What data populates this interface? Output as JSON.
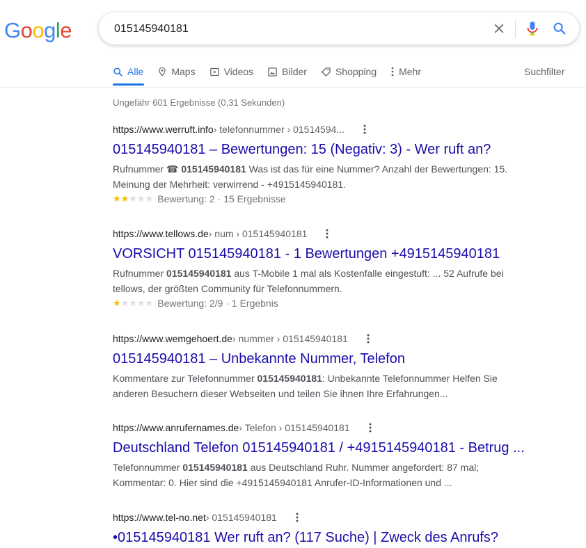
{
  "header": {
    "logo_letters": [
      "G",
      "o",
      "o",
      "g",
      "l",
      "e"
    ],
    "logo_colors": [
      "#4285F4",
      "#EA4335",
      "#FBBC05",
      "#4285F4",
      "#34A853",
      "#EA4335"
    ],
    "search_value": "015145940181"
  },
  "tabs": [
    {
      "label": "Alle",
      "icon": "search-icon",
      "active": true
    },
    {
      "label": "Maps",
      "icon": "map-pin-icon",
      "active": false
    },
    {
      "label": "Videos",
      "icon": "video-icon",
      "active": false
    },
    {
      "label": "Bilder",
      "icon": "image-icon",
      "active": false
    },
    {
      "label": "Shopping",
      "icon": "tag-icon",
      "active": false
    },
    {
      "label": "Mehr",
      "icon": "more-vert-icon",
      "active": false
    }
  ],
  "suchfilter_label": "Suchfilter",
  "stats": "Ungefähr 601 Ergebnisse (0,31 Sekunden)",
  "results": [
    {
      "domain": "https://www.werruft.info",
      "crumbs": " › telefonnummer › 01514594...",
      "title": "015145940181 – Bewertungen: 15 (Negativ: 3) - Wer ruft an?",
      "snippet": [
        {
          "t": "Rufnummer ☎ ",
          "b": false
        },
        {
          "t": "015145940181",
          "b": true
        },
        {
          "t": " Was ist das für eine Nummer? Anzahl der Bewertungen: 15. Meinung der Mehrheit: verwirrend - +4915145940181.",
          "b": false
        }
      ],
      "rating_fraction": 0.4,
      "rating_text": "Bewertung: 2 · 15 Ergebnisse"
    },
    {
      "domain": "https://www.tellows.de",
      "crumbs": " › num › 015145940181",
      "title": "VORSICHT 015145940181 - 1 Bewertungen +4915145940181",
      "snippet": [
        {
          "t": "Rufnummer ",
          "b": false
        },
        {
          "t": "015145940181",
          "b": true
        },
        {
          "t": " aus T-Mobile 1 mal als Kostenfalle eingestuft: ... 52 Aufrufe bei tellows, der größten Community für Telefonnummern.",
          "b": false
        }
      ],
      "rating_fraction": 0.222,
      "rating_text": "Bewertung: 2/9 · 1 Ergebnis"
    },
    {
      "domain": "https://www.wemgehoert.de",
      "crumbs": " › nummer › 015145940181",
      "title": "015145940181 – Unbekannte Nummer, Telefon",
      "snippet": [
        {
          "t": "Kommentare zur Telefonnummer ",
          "b": false
        },
        {
          "t": "015145940181",
          "b": true
        },
        {
          "t": ": Unbekannte Telefonnummer Helfen Sie anderen Besuchern dieser Webseiten und teilen Sie ihnen Ihre Erfahrungen...",
          "b": false
        }
      ]
    },
    {
      "domain": "https://www.anrufernames.de",
      "crumbs": " › Telefon › 015145940181",
      "title": "Deutschland Telefon 015145940181 / +4915145940181 - Betrug ...",
      "snippet": [
        {
          "t": "Telefonnummer ",
          "b": false
        },
        {
          "t": "015145940181",
          "b": true
        },
        {
          "t": " aus Deutschland Ruhr. Nummer angefordert: 87 mal; Kommentar: 0. Hier sind die +4915145940181 Anrufer-ID-Informationen und ...",
          "b": false
        }
      ]
    },
    {
      "domain": "https://www.tel-no.net",
      "crumbs": " › 015145940181",
      "title": "•015145940181 Wer ruft an? (117 Suche) | Zweck des Anrufs?",
      "snippet": []
    }
  ]
}
